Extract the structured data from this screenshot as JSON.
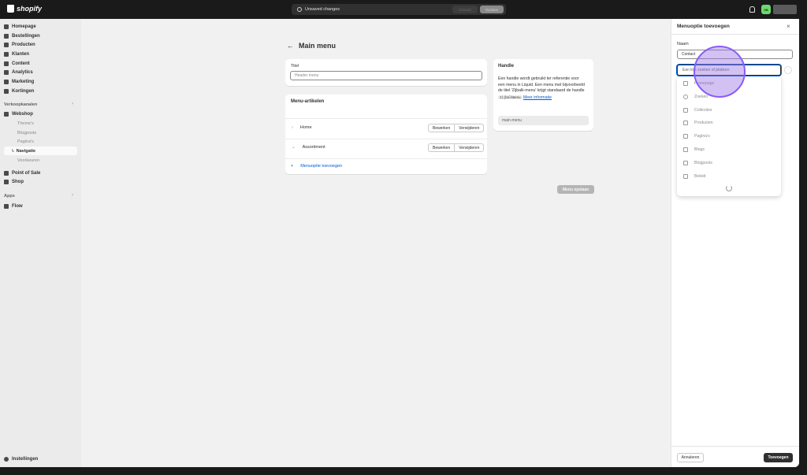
{
  "topbar": {
    "brand": "shopify",
    "status": "Unsaved changes",
    "discard_label": "Discard",
    "save_label": "Opslaan",
    "avatar_initials": "SB"
  },
  "sidebar": {
    "items": [
      {
        "label": "Homepage",
        "icon": "home-icon"
      },
      {
        "label": "Bestellingen",
        "icon": "inbox-icon"
      },
      {
        "label": "Producten",
        "icon": "tag-icon"
      },
      {
        "label": "Klanten",
        "icon": "person-icon"
      },
      {
        "label": "Content",
        "icon": "content-icon"
      },
      {
        "label": "Analytics",
        "icon": "chart-icon"
      },
      {
        "label": "Marketing",
        "icon": "target-icon"
      },
      {
        "label": "Kortingen",
        "icon": "discount-icon"
      }
    ],
    "sales_channels_label": "Verkoopkanalen",
    "webshop_label": "Webshop",
    "webshop_sub": [
      "Theme's",
      "Blogposts",
      "Pagina's",
      "Navigatie",
      "Voorkeuren"
    ],
    "pos_label": "Point of Sale",
    "shop_label": "Shop",
    "apps_label": "Apps",
    "flow_label": "Flow",
    "settings_label": "Instellingen"
  },
  "main": {
    "back_arrow": "←",
    "title": "Main menu",
    "title_label": "Titel",
    "title_value": "Header menu",
    "menu_items_heading": "Menu-artikelen",
    "menu_rows": [
      {
        "caret": "›",
        "label": "Home",
        "edit": "Bewerken",
        "delete": "Verwijderen"
      },
      {
        "caret": "⌄",
        "label": "Assortiment",
        "edit": "Bewerken",
        "delete": "Verwijderen"
      }
    ],
    "add_item_plus": "+",
    "add_item_label": "Menuoptie toevoegen",
    "save_menu_label": "Menu opslaan",
    "handle": {
      "heading": "Handle",
      "text_part1": "Een handle wordt gebruikt ter referentie voor een menu in Liquid. Een menu met bijvoorbeeld de titel 'Zijbalk-menu' krijgt standaard de handle",
      "code": "zijbalkmenu",
      "link": "Meer informatie",
      "value": "main-menu"
    }
  },
  "panel": {
    "title": "Menuoptie toevoegen",
    "close": "×",
    "name_label": "Naam",
    "name_value": "Contact",
    "link_placeholder": "Een link zoeken of plakken",
    "options": [
      {
        "label": "Homepage",
        "icon": "home-icon"
      },
      {
        "label": "Zoeken",
        "icon": "search-icon"
      },
      {
        "label": "Collecties",
        "icon": "collection-icon"
      },
      {
        "label": "Producten",
        "icon": "tag-icon"
      },
      {
        "label": "Pagina's",
        "icon": "page-icon"
      },
      {
        "label": "Blogs",
        "icon": "blog-icon"
      },
      {
        "label": "Blogposts",
        "icon": "blogpost-icon"
      },
      {
        "label": "Beleid",
        "icon": "policy-icon"
      }
    ],
    "cancel_label": "Annuleren",
    "add_label": "Toevoegen"
  }
}
